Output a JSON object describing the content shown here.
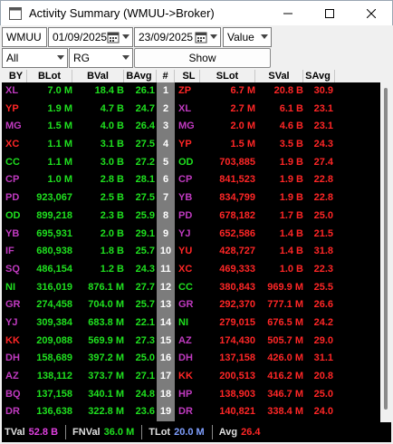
{
  "window": {
    "title": "Activity Summary (WMUU->Broker)"
  },
  "filters": {
    "stock": "WMUU",
    "date_from": "01/09/2025",
    "date_to": "23/09/2025",
    "metric": "Value",
    "scope": "All",
    "broker": "RG",
    "show_label": "Show"
  },
  "table": {
    "headers": {
      "by": "BY",
      "blot": "BLot",
      "bval": "BVal",
      "bavg": "BAvg",
      "num": "#",
      "sl": "SL",
      "slot": "SLot",
      "sval": "SVal",
      "savg": "SAvg"
    },
    "rows": [
      {
        "by": "XL",
        "blot": "7.0 M",
        "bval": "18.4 B",
        "bavg": "26.1",
        "num": "1",
        "sl": "ZP",
        "slot": "6.7 M",
        "sval": "20.8 B",
        "savg": "30.9"
      },
      {
        "by": "YP",
        "blot": "1.9 M",
        "bval": "4.7 B",
        "bavg": "24.7",
        "num": "2",
        "sl": "XL",
        "slot": "2.7 M",
        "sval": "6.1 B",
        "savg": "23.1"
      },
      {
        "by": "MG",
        "blot": "1.5 M",
        "bval": "4.0 B",
        "bavg": "26.4",
        "num": "3",
        "sl": "MG",
        "slot": "2.0 M",
        "sval": "4.6 B",
        "savg": "23.1"
      },
      {
        "by": "XC",
        "blot": "1.1 M",
        "bval": "3.1 B",
        "bavg": "27.5",
        "num": "4",
        "sl": "YP",
        "slot": "1.5 M",
        "sval": "3.5 B",
        "savg": "24.3"
      },
      {
        "by": "CC",
        "blot": "1.1 M",
        "bval": "3.0 B",
        "bavg": "27.2",
        "num": "5",
        "sl": "OD",
        "slot": "703,885",
        "sval": "1.9 B",
        "savg": "27.4"
      },
      {
        "by": "CP",
        "blot": "1.0 M",
        "bval": "2.8 B",
        "bavg": "28.1",
        "num": "6",
        "sl": "CP",
        "slot": "841,523",
        "sval": "1.9 B",
        "savg": "22.8"
      },
      {
        "by": "PD",
        "blot": "923,067",
        "bval": "2.5 B",
        "bavg": "27.5",
        "num": "7",
        "sl": "YB",
        "slot": "834,799",
        "sval": "1.9 B",
        "savg": "22.8"
      },
      {
        "by": "OD",
        "blot": "899,218",
        "bval": "2.3 B",
        "bavg": "25.9",
        "num": "8",
        "sl": "PD",
        "slot": "678,182",
        "sval": "1.7 B",
        "savg": "25.0"
      },
      {
        "by": "YB",
        "blot": "695,931",
        "bval": "2.0 B",
        "bavg": "29.1",
        "num": "9",
        "sl": "YJ",
        "slot": "652,586",
        "sval": "1.4 B",
        "savg": "21.5"
      },
      {
        "by": "IF",
        "blot": "680,938",
        "bval": "1.8 B",
        "bavg": "25.7",
        "num": "10",
        "sl": "YU",
        "slot": "428,727",
        "sval": "1.4 B",
        "savg": "31.8"
      },
      {
        "by": "SQ",
        "blot": "486,154",
        "bval": "1.2 B",
        "bavg": "24.3",
        "num": "11",
        "sl": "XC",
        "slot": "469,333",
        "sval": "1.0 B",
        "savg": "22.3"
      },
      {
        "by": "NI",
        "blot": "316,019",
        "bval": "876.1 M",
        "bavg": "27.7",
        "num": "12",
        "sl": "CC",
        "slot": "380,843",
        "sval": "969.9 M",
        "savg": "25.5"
      },
      {
        "by": "GR",
        "blot": "274,458",
        "bval": "704.0 M",
        "bavg": "25.7",
        "num": "13",
        "sl": "GR",
        "slot": "292,370",
        "sval": "777.1 M",
        "savg": "26.6"
      },
      {
        "by": "YJ",
        "blot": "309,384",
        "bval": "683.8 M",
        "bavg": "22.1",
        "num": "14",
        "sl": "NI",
        "slot": "279,015",
        "sval": "676.5 M",
        "savg": "24.2"
      },
      {
        "by": "KK",
        "blot": "209,088",
        "bval": "569.9 M",
        "bavg": "27.3",
        "num": "15",
        "sl": "AZ",
        "slot": "174,430",
        "sval": "505.7 M",
        "savg": "29.0"
      },
      {
        "by": "DH",
        "blot": "158,689",
        "bval": "397.2 M",
        "bavg": "25.0",
        "num": "16",
        "sl": "DH",
        "slot": "137,158",
        "sval": "426.0 M",
        "savg": "31.1"
      },
      {
        "by": "AZ",
        "blot": "138,112",
        "bval": "373.7 M",
        "bavg": "27.1",
        "num": "17",
        "sl": "KK",
        "slot": "200,513",
        "sval": "416.2 M",
        "savg": "20.8"
      },
      {
        "by": "BQ",
        "blot": "137,158",
        "bval": "340.1 M",
        "bavg": "24.8",
        "num": "18",
        "sl": "HP",
        "slot": "138,903",
        "sval": "346.7 M",
        "savg": "25.0"
      },
      {
        "by": "DR",
        "blot": "136,638",
        "bval": "322.8 M",
        "bavg": "23.6",
        "num": "19",
        "sl": "DR",
        "slot": "140,821",
        "sval": "338.4 M",
        "savg": "24.0"
      }
    ]
  },
  "summary": {
    "tval_label": "TVal",
    "tval": "52.8 B",
    "fnval_label": "FNVal",
    "fnval": "36.0 M",
    "tlot_label": "TLot",
    "tlot": "20.0 M",
    "avg_label": "Avg",
    "avg": "26.4"
  },
  "colors": {
    "buy": "#1fe01f",
    "sell": "#ff2626",
    "broker": "#c03ac0",
    "grid_bg": "#000000"
  },
  "icons": {
    "app": "window-app-icon",
    "calendar": "calendar-icon",
    "minimize": "minimize-icon",
    "maximize": "maximize-icon",
    "close": "close-icon"
  }
}
